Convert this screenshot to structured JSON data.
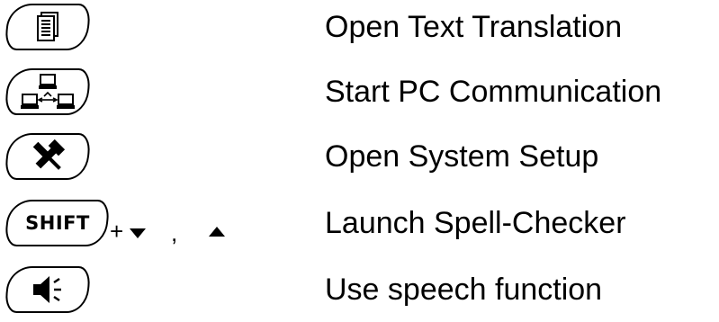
{
  "legend": {
    "rows": [
      {
        "icon": "document-icon",
        "description": "Open Text Translation"
      },
      {
        "icon": "network-icon",
        "description": "Start PC Communication"
      },
      {
        "icon": "tools-icon",
        "description": "Open System Setup"
      },
      {
        "icon": "shift-key",
        "key_label": "SHIFT",
        "plus": "+",
        "comma": ",",
        "description": "Launch Spell-Checker"
      },
      {
        "icon": "speaker-icon",
        "description": "Use speech function"
      }
    ]
  }
}
